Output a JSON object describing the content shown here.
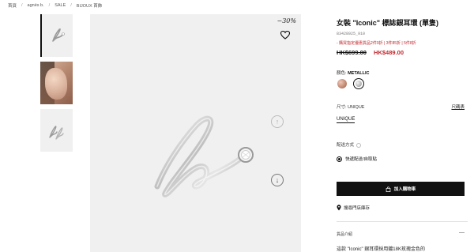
{
  "breadcrumb": [
    "首頁",
    "agnès b.",
    "SALE",
    "BIJOUX 首飾"
  ],
  "breadcrumb_sep": "/",
  "gallery": {
    "thumbnails": [
      {
        "name": "product-thumb-silhouette",
        "active": true
      },
      {
        "name": "product-thumb-model",
        "active": false
      },
      {
        "name": "product-thumb-detail",
        "active": false
      }
    ],
    "discount_badge": "−30%",
    "icons": [
      "heart-icon",
      "arrow-up-icon",
      "arrow-down-icon"
    ]
  },
  "product": {
    "title": "女裝 \"Iconic\" 標誌銀耳環 (單隻)",
    "sku": "83428925_910",
    "promo": "- 購買指定優惠貨品2件9折 | 3件85折 | 5件8折",
    "price_original": "HK$699.00",
    "price_sale": "HK$489.00",
    "color_label": "顏色:",
    "color_value": "METALLIC",
    "size_label": "尺寸:",
    "size_value": "UNIQUE",
    "size_guide": "尺碼表",
    "size_option": "UNIQUE",
    "shipping_label": "配送方式",
    "shipping_option": "快遞配送/自取貼",
    "add_to_cart": "加入購物車",
    "store_stock": "搜尋門店庫存",
    "description_label": "貨品介紹",
    "description_toggle": "—",
    "description_text": "這款 \"Iconic\" 銀耳環採用鍍18K玫瑰金色的"
  },
  "colors": {
    "accent_red": "#c0272d",
    "button_black": "#111111"
  }
}
